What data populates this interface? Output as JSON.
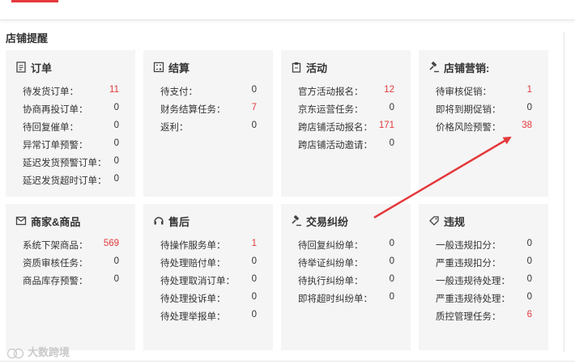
{
  "section_title": "店铺提醒",
  "colors": {
    "accent": "#e4393c",
    "card_bg": "#f5f5f5"
  },
  "cards": [
    {
      "title": "订单",
      "icon": "document-icon",
      "rows": [
        {
          "label": "待发货订单：",
          "value": "11",
          "alert": true
        },
        {
          "label": "协商再投订单：",
          "value": "0",
          "alert": false
        },
        {
          "label": "待回复催单：",
          "value": "0",
          "alert": false
        },
        {
          "label": "异常订单预警：",
          "value": "0",
          "alert": false
        },
        {
          "label": "延迟发货预警订单：",
          "value": "0",
          "alert": false
        },
        {
          "label": "延迟发货超时订单：",
          "value": "0",
          "alert": false
        }
      ]
    },
    {
      "title": "结算",
      "icon": "calculator-icon",
      "rows": [
        {
          "label": "待支付：",
          "value": "0",
          "alert": false
        },
        {
          "label": "财务结算任务：",
          "value": "7",
          "alert": true
        },
        {
          "label": "返利：",
          "value": "0",
          "alert": false
        }
      ]
    },
    {
      "title": "活动",
      "icon": "clipboard-icon",
      "rows": [
        {
          "label": "官方活动报名：",
          "value": "12",
          "alert": true
        },
        {
          "label": "京东运营任务：",
          "value": "0",
          "alert": false
        },
        {
          "label": "跨店铺活动报名：",
          "value": "171",
          "alert": true
        },
        {
          "label": "跨店铺活动邀请：",
          "value": "0",
          "alert": false
        }
      ]
    },
    {
      "title": "店铺营销:",
      "icon": "gavel-icon",
      "rows": [
        {
          "label": "待审核促销：",
          "value": "1",
          "alert": true
        },
        {
          "label": "即将到期促销：",
          "value": "0",
          "alert": false
        },
        {
          "label": "价格风险预警：",
          "value": "38",
          "alert": true
        }
      ]
    },
    {
      "title": "商家&商品",
      "icon": "mail-icon",
      "rows": [
        {
          "label": "系统下架商品：",
          "value": "569",
          "alert": true
        },
        {
          "label": "资质审核任务：",
          "value": "0",
          "alert": false
        },
        {
          "label": "商品库存预警：",
          "value": "0",
          "alert": false
        }
      ]
    },
    {
      "title": "售后",
      "icon": "headset-icon",
      "rows": [
        {
          "label": "待操作服务单：",
          "value": "1",
          "alert": true
        },
        {
          "label": "待处理赔付单：",
          "value": "0",
          "alert": false
        },
        {
          "label": "待处理取消订单：",
          "value": "0",
          "alert": false
        },
        {
          "label": "待处理投诉单：",
          "value": "0",
          "alert": false
        },
        {
          "label": "待处理举报单：",
          "value": "0",
          "alert": false
        }
      ]
    },
    {
      "title": "交易纠纷",
      "icon": "gavel-icon",
      "rows": [
        {
          "label": "待回复纠纷单：",
          "value": "0",
          "alert": false
        },
        {
          "label": "待举证纠纷单：",
          "value": "0",
          "alert": false
        },
        {
          "label": "待执行纠纷单：",
          "value": "0",
          "alert": false
        },
        {
          "label": "即将超时纠纷单：",
          "value": "0",
          "alert": false
        }
      ]
    },
    {
      "title": "违规",
      "icon": "tag-icon",
      "rows": [
        {
          "label": "一般违规扣分：",
          "value": "0",
          "alert": false
        },
        {
          "label": "严重违规扣分：",
          "value": "0",
          "alert": false
        },
        {
          "label": "一般违规待处理：",
          "value": "0",
          "alert": false
        },
        {
          "label": "严重违规待处理：",
          "value": "0",
          "alert": false
        },
        {
          "label": "质控管理任务：",
          "value": "6",
          "alert": true
        }
      ]
    }
  ],
  "watermark": {
    "text": "大数跨境"
  }
}
